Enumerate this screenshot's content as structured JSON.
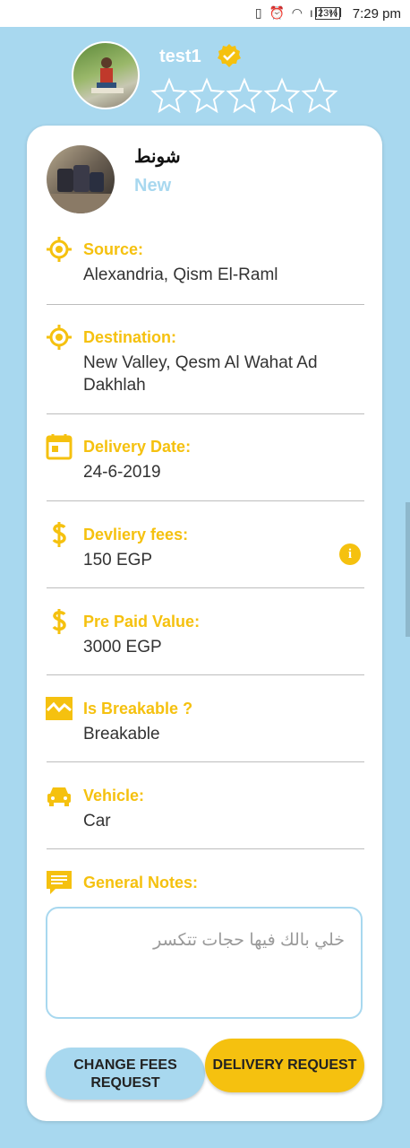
{
  "statusbar": {
    "battery": "23%",
    "time": "7:29 pm"
  },
  "profile": {
    "name": "test1",
    "rating_stars_filled": 0,
    "rating_stars_total": 5,
    "verified": true
  },
  "item": {
    "title": "شونط",
    "status": "New"
  },
  "fields": {
    "source": {
      "label": "Source:",
      "value": "Alexandria, Qism El-Raml",
      "icon": "target-icon"
    },
    "destination": {
      "label": "Destination:",
      "value": "New Valley, Qesm Al Wahat Ad Dakhlah",
      "icon": "target-icon"
    },
    "delivery_date": {
      "label": "Delivery Date:",
      "value": "24-6-2019",
      "icon": "calendar-icon"
    },
    "delivery_fees": {
      "label": "Devliery fees:",
      "value": "150 EGP",
      "icon": "dollar-icon"
    },
    "prepaid": {
      "label": "Pre Paid Value:",
      "value": "3000 EGP",
      "icon": "dollar-icon"
    },
    "breakable": {
      "label": "Is Breakable ?",
      "value": "Breakable",
      "icon": "broken-box-icon"
    },
    "vehicle": {
      "label": "Vehicle:",
      "value": "Car",
      "icon": "car-icon"
    },
    "notes": {
      "label": "General Notes:",
      "value": "خلي بالك فيها حجات تتكسر",
      "icon": "comment-icon"
    }
  },
  "buttons": {
    "change_fees": "CHANGE FEES REQUEST",
    "delivery_request": "DELIVERY REQUEST"
  },
  "colors": {
    "background": "#a8d8ef",
    "accent": "#f5c10f",
    "card": "#ffffff"
  }
}
